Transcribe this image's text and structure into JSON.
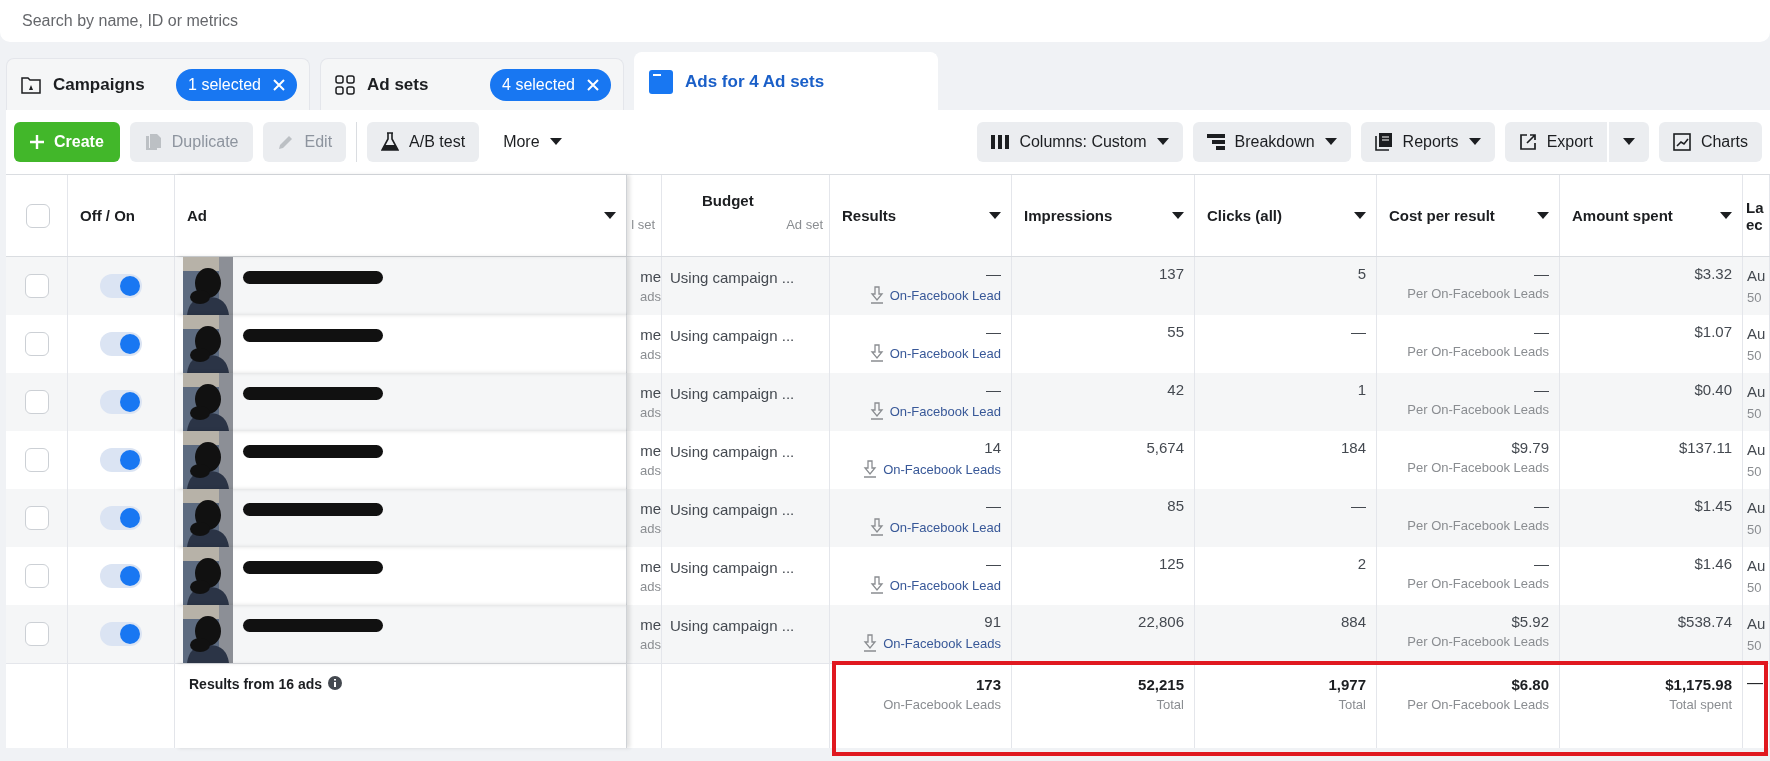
{
  "search": {
    "placeholder": "Search by name, ID or metrics"
  },
  "tabs": [
    {
      "label": "Campaigns",
      "badge": "1 selected",
      "selected": false
    },
    {
      "label": "Ad sets",
      "badge": "4 selected",
      "selected": false
    },
    {
      "label": "Ads for 4 Ad sets",
      "selected": true
    }
  ],
  "toolbar": [
    {
      "label": "Create",
      "kind": "primary",
      "disabled": false
    },
    {
      "label": "Duplicate",
      "kind": "default",
      "disabled": true
    },
    {
      "label": "Edit",
      "kind": "default",
      "disabled": true
    },
    {
      "label": "A/B test",
      "kind": "default",
      "disabled": false
    },
    {
      "label": "More",
      "kind": "plain",
      "disabled": false
    }
  ],
  "toolbar_right": [
    {
      "label": "Columns: Custom",
      "kind": "menu"
    },
    {
      "label": "Breakdown",
      "kind": "menu"
    },
    {
      "label": "Reports",
      "kind": "menu"
    },
    {
      "label": "Export",
      "kind": "split"
    },
    {
      "label": "Charts",
      "kind": "plain"
    }
  ],
  "table": {
    "header_checkbox": {
      "checked": false
    },
    "columns": [
      {
        "label": "Off / On",
        "dropdown": false
      },
      {
        "label": "Ad",
        "dropdown": true
      },
      {
        "sub": "l set",
        "dropdown": false
      },
      {
        "label": "Budget",
        "sub": "Ad set",
        "dropdown": false
      },
      {
        "label": "Results",
        "dropdown": true
      },
      {
        "label": "Impressions",
        "dropdown": true
      },
      {
        "label": "Clicks (all)",
        "dropdown": true
      },
      {
        "label": "Cost per result",
        "dropdown": true
      },
      {
        "label": "Amount spent",
        "dropdown": true
      },
      {
        "label": "La\nec",
        "dropdown": false
      }
    ],
    "rows": [
      {
        "checked": false,
        "on": true,
        "column_3": [
          "me",
          "ads"
        ],
        "budget": "Using campaign ...",
        "results": {
          "value": "—",
          "label": "On-Facebook Lead"
        },
        "impressions": "137",
        "clicks": "5",
        "cost": {
          "value": "—",
          "sub": "Per On-Facebook Leads"
        },
        "amount": "$3.32",
        "column_11": [
          "Au",
          "50"
        ]
      },
      {
        "checked": false,
        "on": true,
        "column_3": [
          "me",
          "ads"
        ],
        "budget": "Using campaign ...",
        "results": {
          "value": "—",
          "label": "On-Facebook Lead"
        },
        "impressions": "55",
        "clicks": "—",
        "cost": {
          "value": "—",
          "sub": "Per On-Facebook Leads"
        },
        "amount": "$1.07",
        "column_11": [
          "Au",
          "50"
        ]
      },
      {
        "checked": false,
        "on": true,
        "column_3": [
          "me",
          "ads"
        ],
        "budget": "Using campaign ...",
        "results": {
          "value": "—",
          "label": "On-Facebook Lead"
        },
        "impressions": "42",
        "clicks": "1",
        "cost": {
          "value": "—",
          "sub": "Per On-Facebook Leads"
        },
        "amount": "$0.40",
        "column_11": [
          "Au",
          "50"
        ]
      },
      {
        "checked": false,
        "on": true,
        "column_3": [
          "me",
          "ads"
        ],
        "budget": "Using campaign ...",
        "results": {
          "value": "14",
          "label": "On-Facebook Leads"
        },
        "impressions": "5,674",
        "clicks": "184",
        "cost": {
          "value": "$9.79",
          "sub": "Per On-Facebook Leads"
        },
        "amount": "$137.11",
        "column_11": [
          "Au",
          "50"
        ]
      },
      {
        "checked": false,
        "on": true,
        "column_3": [
          "me",
          "ads"
        ],
        "budget": "Using campaign ...",
        "results": {
          "value": "—",
          "label": "On-Facebook Lead"
        },
        "impressions": "85",
        "clicks": "—",
        "cost": {
          "value": "—",
          "sub": "Per On-Facebook Leads"
        },
        "amount": "$1.45",
        "column_11": [
          "Au",
          "50"
        ]
      },
      {
        "checked": false,
        "on": true,
        "column_3": [
          "me",
          "ads"
        ],
        "budget": "Using campaign ...",
        "results": {
          "value": "—",
          "label": "On-Facebook Lead"
        },
        "impressions": "125",
        "clicks": "2",
        "cost": {
          "value": "—",
          "sub": "Per On-Facebook Leads"
        },
        "amount": "$1.46",
        "column_11": [
          "Au",
          "50"
        ]
      },
      {
        "checked": false,
        "on": true,
        "column_3": [
          "me",
          "ads"
        ],
        "budget": "Using campaign ...",
        "results": {
          "value": "91",
          "label": "On-Facebook Leads"
        },
        "impressions": "22,806",
        "clicks": "884",
        "cost": {
          "value": "$5.92",
          "sub": "Per On-Facebook Leads"
        },
        "amount": "$538.74",
        "column_11": [
          "Au",
          "50"
        ]
      }
    ],
    "totals": {
      "label": "Results from 16 ads",
      "results": {
        "value": "173",
        "sub": "On-Facebook Leads"
      },
      "impressions": {
        "value": "52,215",
        "sub": "Total"
      },
      "clicks": {
        "value": "1,977",
        "sub": "Total"
      },
      "cost": {
        "value": "$6.80",
        "sub": "Per On-Facebook Leads"
      },
      "amount": {
        "value": "$1,175.98",
        "sub": "Total spent"
      },
      "column_11": "—"
    }
  }
}
